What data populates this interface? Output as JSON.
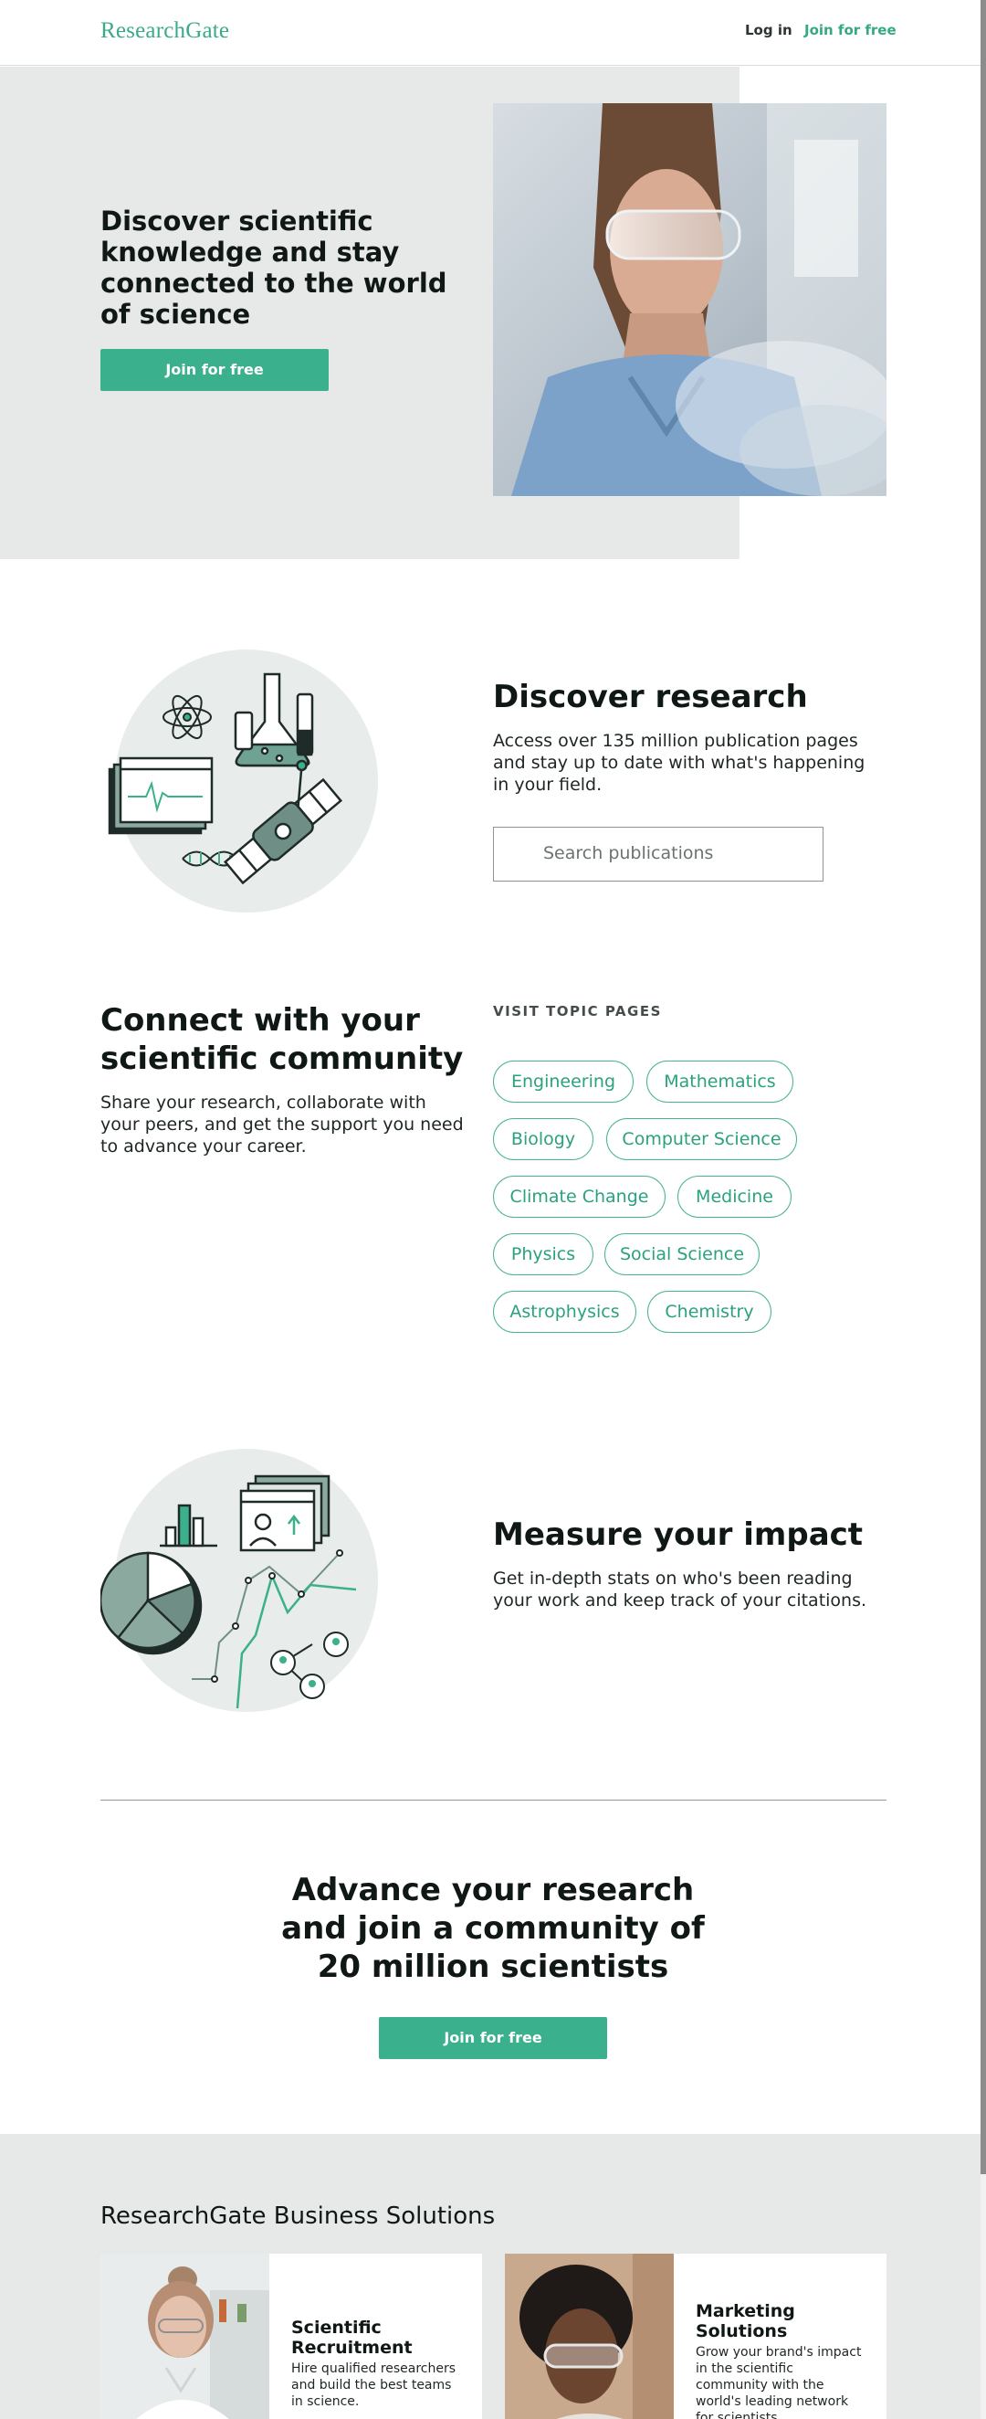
{
  "header": {
    "logo": "ResearchGate",
    "login_label": "Log in",
    "join_label": "Join for free"
  },
  "hero": {
    "title": "Discover scientific knowledge and stay connected to the world of science",
    "button_label": "Join for free"
  },
  "discover": {
    "title": "Discover research",
    "description": "Access over 135 million publication pages and stay up to date with what's happening in your field.",
    "search_placeholder": "Search publications"
  },
  "connect": {
    "title": "Connect with your scientific community",
    "description": "Share your research, collaborate with your peers, and get the support you need to advance your career.",
    "topics_label": "VISIT TOPIC PAGES",
    "topics": [
      "Engineering",
      "Mathematics",
      "Biology",
      "Computer Science",
      "Climate Change",
      "Medicine",
      "Physics",
      "Social Science",
      "Astrophysics",
      "Chemistry"
    ]
  },
  "impact": {
    "title": "Measure your impact",
    "description": "Get in-depth stats on who's been reading your work and keep track of your citations."
  },
  "cta": {
    "title": "Advance your research and join a community of 20 million scientists",
    "button_label": "Join for free"
  },
  "business": {
    "title": "ResearchGate Business Solutions",
    "cards": [
      {
        "title": "Scientific Recruitment",
        "description": "Hire qualified researchers and build the best teams in science."
      },
      {
        "title": "Marketing Solutions",
        "description": "Grow your brand's impact in the scientific community with the world's leading network for scientists."
      }
    ]
  },
  "colors": {
    "brand_green": "#3ab08c",
    "light_gray_bg": "#e6e9e8",
    "dark_text": "#101816"
  }
}
